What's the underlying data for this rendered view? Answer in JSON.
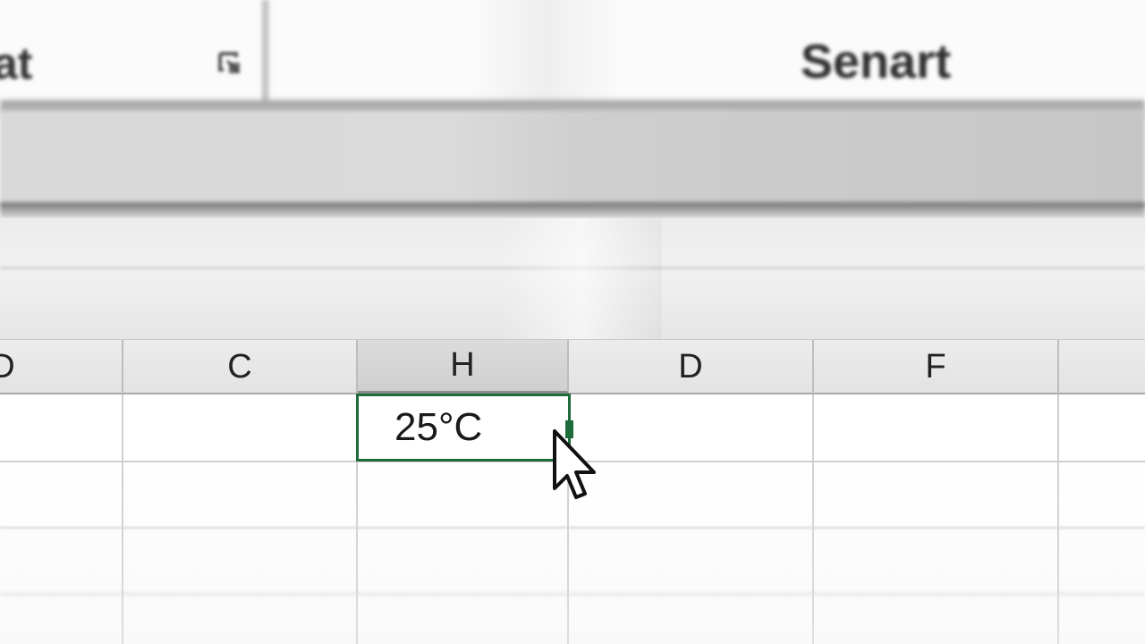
{
  "ribbon": {
    "top_text_left": "",
    "top_text_right": "",
    "group_label_left": "at",
    "group_label_right": "Senart",
    "launcher_icon": "dialog-launcher-icon"
  },
  "sheet": {
    "column_headers": [
      "D",
      "C",
      "H",
      "D",
      "F"
    ],
    "selected_column": "H",
    "active_cell": {
      "value": "25°C"
    }
  },
  "colors": {
    "active_cell_border": "#1e6b3b",
    "gridline": "#cfcfcf",
    "header_bg": "#e6e6e6"
  },
  "cursor": "mouse-pointer-icon"
}
